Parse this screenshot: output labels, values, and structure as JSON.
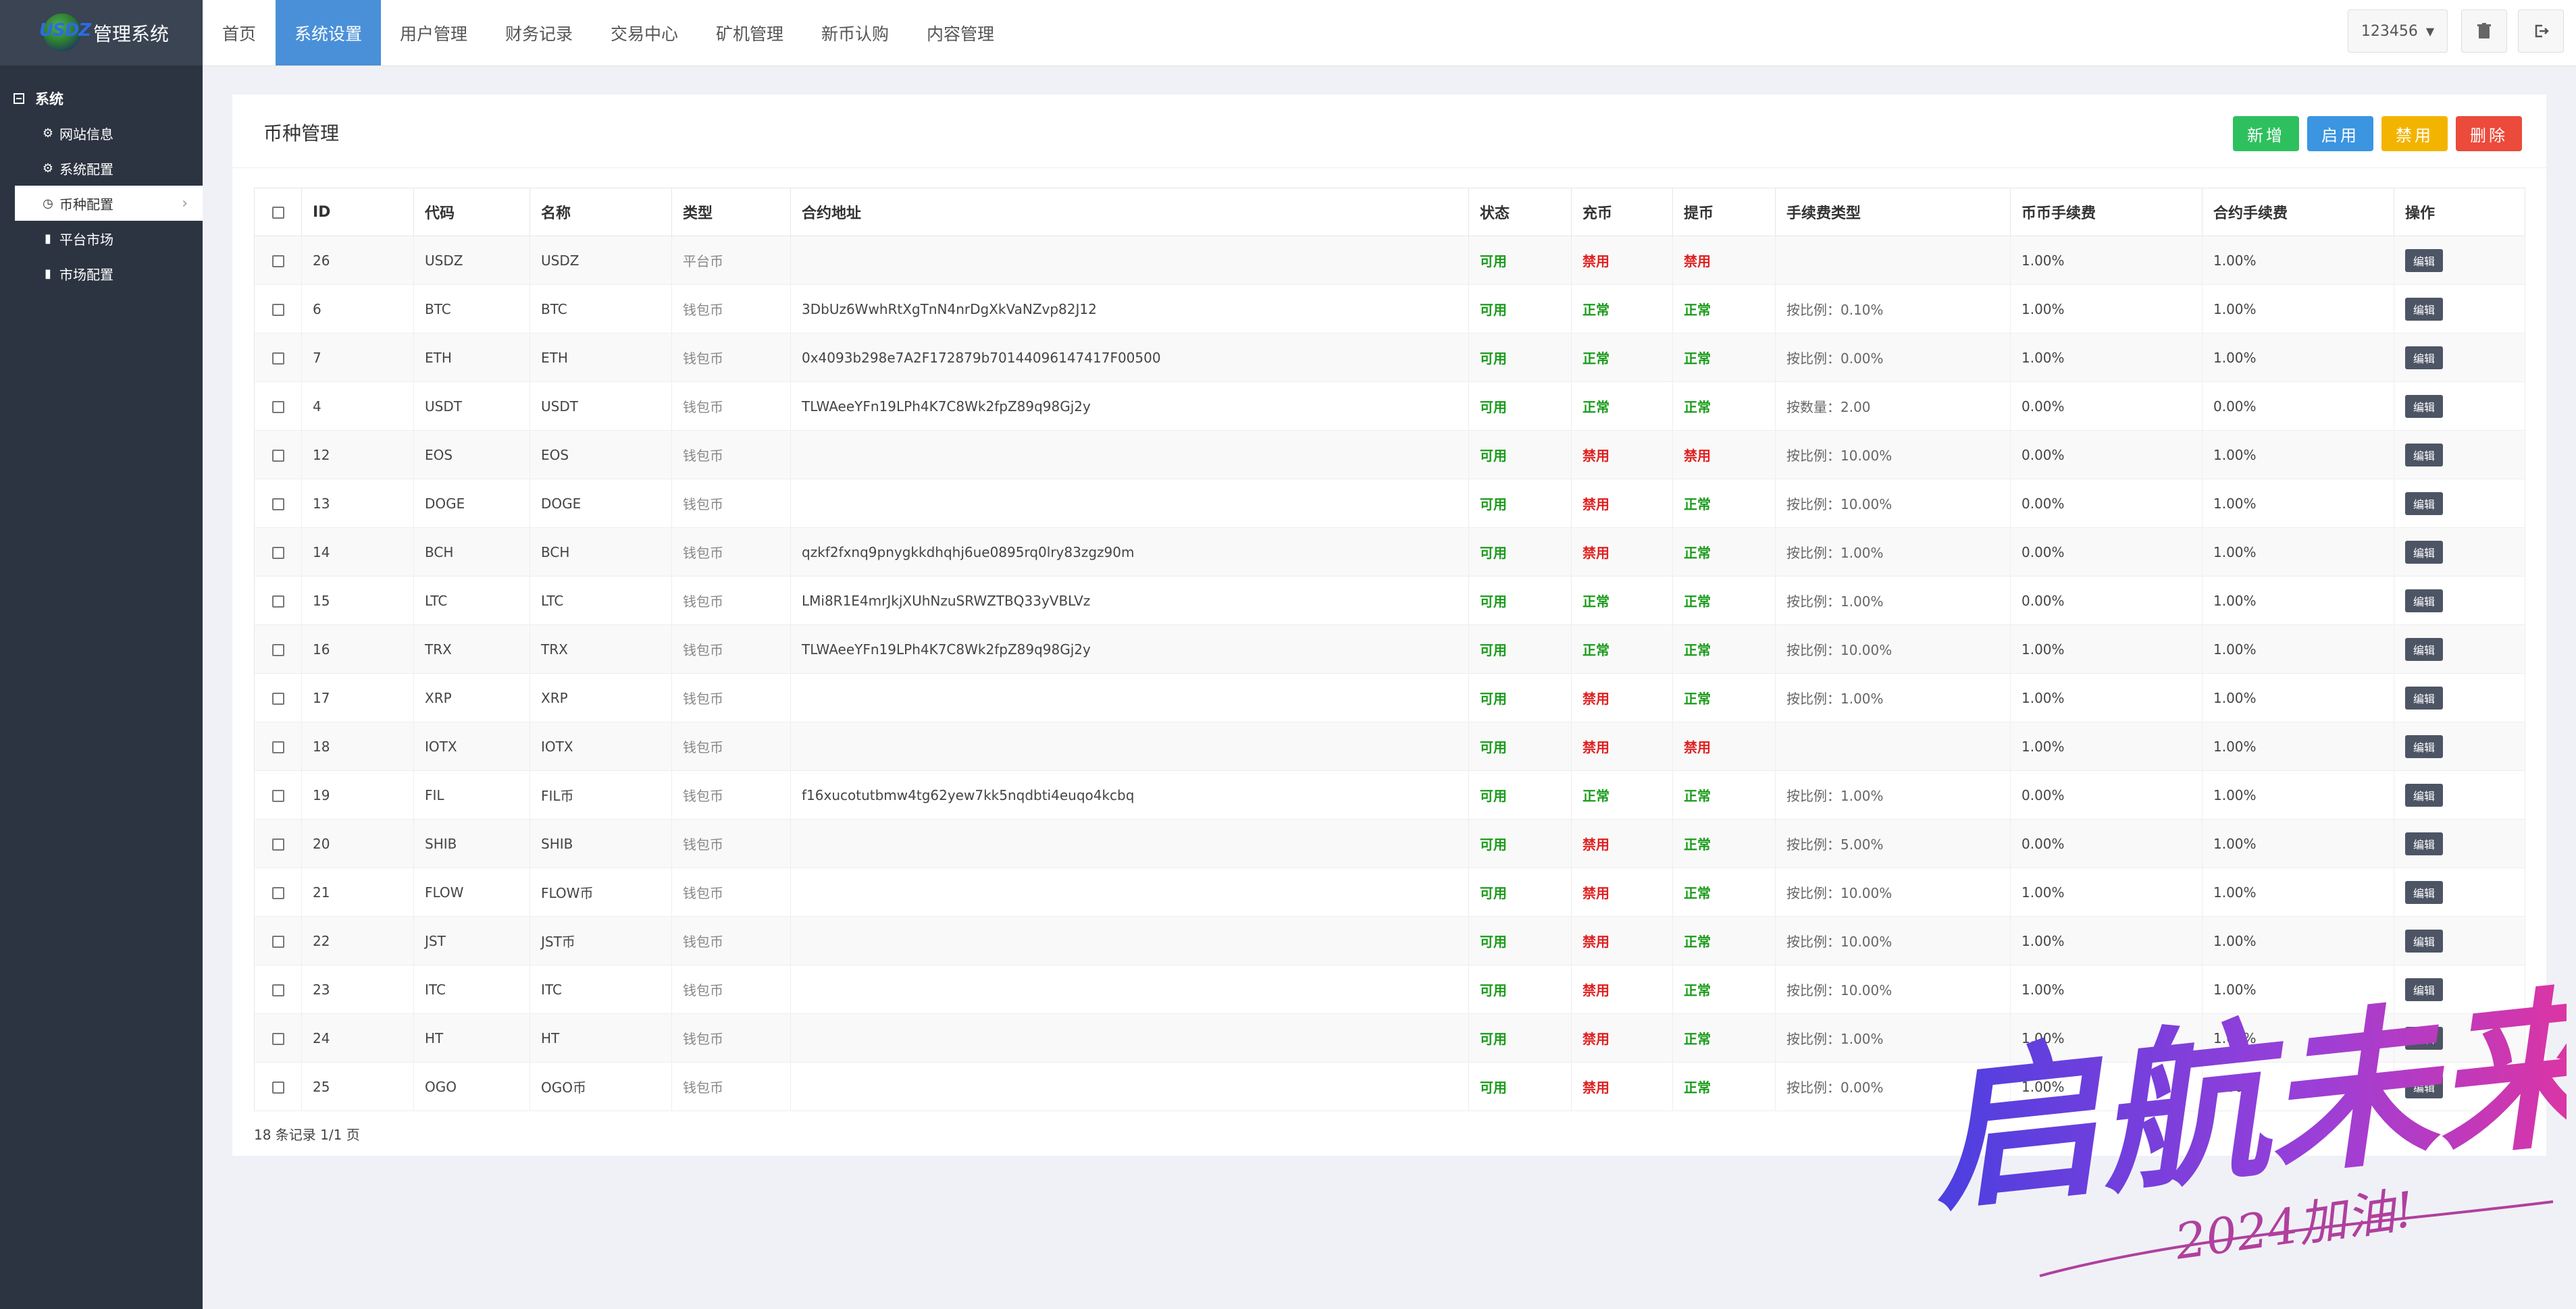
{
  "app": {
    "logo_text": "USDZ",
    "title": "管理系统"
  },
  "sidebar": {
    "group": "系统",
    "items": [
      {
        "label": "网站信息",
        "icon": "gear-icon"
      },
      {
        "label": "系统配置",
        "icon": "gear-icon"
      },
      {
        "label": "币种配置",
        "icon": "clock-icon",
        "active": true
      },
      {
        "label": "平台市场",
        "icon": "bar-chart-icon"
      },
      {
        "label": "市场配置",
        "icon": "bar-chart-icon"
      }
    ]
  },
  "nav": {
    "tabs": [
      "首页",
      "系统设置",
      "用户管理",
      "财务记录",
      "交易中心",
      "矿机管理",
      "新币认购",
      "内容管理"
    ],
    "active": "系统设置",
    "user": "123456"
  },
  "panel": {
    "title": "币种管理",
    "buttons": {
      "add": "新增",
      "enable": "启用",
      "disable": "禁用",
      "delete": "删除"
    },
    "columns": [
      "ID",
      "代码",
      "名称",
      "类型",
      "合约地址",
      "状态",
      "充币",
      "提币",
      "手续费类型",
      "币币手续费",
      "合约手续费",
      "操作"
    ],
    "edit_label": "编辑",
    "rows": [
      {
        "id": "26",
        "code": "USDZ",
        "name": "USDZ",
        "type": "平台币",
        "address": "",
        "status": "可用",
        "deposit": "禁用",
        "withdraw": "禁用",
        "fee_type": "",
        "spot_fee": "1.00%",
        "contract_fee": "1.00%"
      },
      {
        "id": "6",
        "code": "BTC",
        "name": "BTC",
        "type": "钱包币",
        "address": "3DbUz6WwhRtXgTnN4nrDgXkVaNZvp82J12",
        "status": "可用",
        "deposit": "正常",
        "withdraw": "正常",
        "fee_type": "按比例：0.10%",
        "spot_fee": "1.00%",
        "contract_fee": "1.00%"
      },
      {
        "id": "7",
        "code": "ETH",
        "name": "ETH",
        "type": "钱包币",
        "address": "0x4093b298e7A2F172879b70144096147417F00500",
        "status": "可用",
        "deposit": "正常",
        "withdraw": "正常",
        "fee_type": "按比例：0.00%",
        "spot_fee": "1.00%",
        "contract_fee": "1.00%"
      },
      {
        "id": "4",
        "code": "USDT",
        "name": "USDT",
        "type": "钱包币",
        "address": "TLWAeeYFn19LPh4K7C8Wk2fpZ89q98Gj2y",
        "status": "可用",
        "deposit": "正常",
        "withdraw": "正常",
        "fee_type": "按数量：2.00",
        "spot_fee": "0.00%",
        "contract_fee": "0.00%"
      },
      {
        "id": "12",
        "code": "EOS",
        "name": "EOS",
        "type": "钱包币",
        "address": "",
        "status": "可用",
        "deposit": "禁用",
        "withdraw": "禁用",
        "fee_type": "按比例：10.00%",
        "spot_fee": "0.00%",
        "contract_fee": "1.00%"
      },
      {
        "id": "13",
        "code": "DOGE",
        "name": "DOGE",
        "type": "钱包币",
        "address": "",
        "status": "可用",
        "deposit": "禁用",
        "withdraw": "正常",
        "fee_type": "按比例：10.00%",
        "spot_fee": "0.00%",
        "contract_fee": "1.00%"
      },
      {
        "id": "14",
        "code": "BCH",
        "name": "BCH",
        "type": "钱包币",
        "address": "qzkf2fxnq9pnygkkdhqhj6ue0895rq0lry83zgz90m",
        "status": "可用",
        "deposit": "禁用",
        "withdraw": "正常",
        "fee_type": "按比例：1.00%",
        "spot_fee": "0.00%",
        "contract_fee": "1.00%"
      },
      {
        "id": "15",
        "code": "LTC",
        "name": "LTC",
        "type": "钱包币",
        "address": "LMi8R1E4mrJkjXUhNzuSRWZTBQ33yVBLVz",
        "status": "可用",
        "deposit": "正常",
        "withdraw": "正常",
        "fee_type": "按比例：1.00%",
        "spot_fee": "0.00%",
        "contract_fee": "1.00%"
      },
      {
        "id": "16",
        "code": "TRX",
        "name": "TRX",
        "type": "钱包币",
        "address": "TLWAeeYFn19LPh4K7C8Wk2fpZ89q98Gj2y",
        "status": "可用",
        "deposit": "正常",
        "withdraw": "正常",
        "fee_type": "按比例：10.00%",
        "spot_fee": "1.00%",
        "contract_fee": "1.00%"
      },
      {
        "id": "17",
        "code": "XRP",
        "name": "XRP",
        "type": "钱包币",
        "address": "",
        "status": "可用",
        "deposit": "禁用",
        "withdraw": "正常",
        "fee_type": "按比例：1.00%",
        "spot_fee": "1.00%",
        "contract_fee": "1.00%"
      },
      {
        "id": "18",
        "code": "IOTX",
        "name": "IOTX",
        "type": "钱包币",
        "address": "",
        "status": "可用",
        "deposit": "禁用",
        "withdraw": "禁用",
        "fee_type": "",
        "spot_fee": "1.00%",
        "contract_fee": "1.00%"
      },
      {
        "id": "19",
        "code": "FIL",
        "name": "FIL币",
        "type": "钱包币",
        "address": "f16xucotutbmw4tg62yew7kk5nqdbti4euqo4kcbq",
        "status": "可用",
        "deposit": "正常",
        "withdraw": "正常",
        "fee_type": "按比例：1.00%",
        "spot_fee": "0.00%",
        "contract_fee": "1.00%"
      },
      {
        "id": "20",
        "code": "SHIB",
        "name": "SHIB",
        "type": "钱包币",
        "address": "",
        "status": "可用",
        "deposit": "禁用",
        "withdraw": "正常",
        "fee_type": "按比例：5.00%",
        "spot_fee": "0.00%",
        "contract_fee": "1.00%"
      },
      {
        "id": "21",
        "code": "FLOW",
        "name": "FLOW币",
        "type": "钱包币",
        "address": "",
        "status": "可用",
        "deposit": "禁用",
        "withdraw": "正常",
        "fee_type": "按比例：10.00%",
        "spot_fee": "1.00%",
        "contract_fee": "1.00%"
      },
      {
        "id": "22",
        "code": "JST",
        "name": "JST币",
        "type": "钱包币",
        "address": "",
        "status": "可用",
        "deposit": "禁用",
        "withdraw": "正常",
        "fee_type": "按比例：10.00%",
        "spot_fee": "1.00%",
        "contract_fee": "1.00%"
      },
      {
        "id": "23",
        "code": "ITC",
        "name": "ITC",
        "type": "钱包币",
        "address": "",
        "status": "可用",
        "deposit": "禁用",
        "withdraw": "正常",
        "fee_type": "按比例：10.00%",
        "spot_fee": "1.00%",
        "contract_fee": "1.00%"
      },
      {
        "id": "24",
        "code": "HT",
        "name": "HT",
        "type": "钱包币",
        "address": "",
        "status": "可用",
        "deposit": "禁用",
        "withdraw": "正常",
        "fee_type": "按比例：1.00%",
        "spot_fee": "1.00%",
        "contract_fee": "1.00%"
      },
      {
        "id": "25",
        "code": "OGO",
        "name": "OGO币",
        "type": "钱包币",
        "address": "",
        "status": "可用",
        "deposit": "禁用",
        "withdraw": "正常",
        "fee_type": "按比例：0.00%",
        "spot_fee": "1.00%",
        "contract_fee": "1.00%"
      }
    ],
    "footer": "18 条记录 1/1 页"
  },
  "watermark": {
    "main": "启航未来",
    "sub": "2024加油!"
  },
  "colors": {
    "sidebar": "#2c3441",
    "nav_active": "#4a90d9",
    "add": "#2ec05e",
    "enable": "#3b95e0",
    "disable": "#f3b400",
    "delete": "#ec4a3a",
    "ok": "#1a9c1a",
    "bad": "#e02020"
  }
}
